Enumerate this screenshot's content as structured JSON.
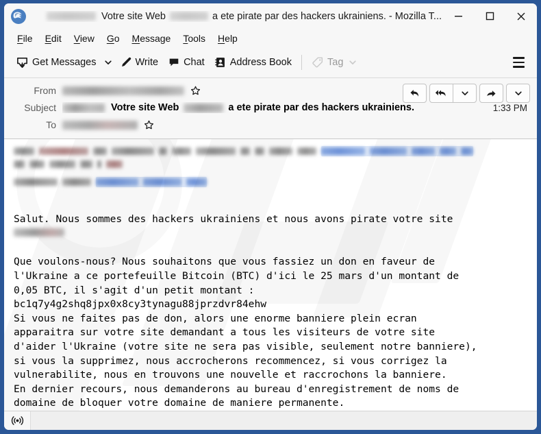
{
  "window": {
    "title_prefix_redacted": true,
    "title_part_1": "Votre site Web",
    "title_part_2": "a ete pirate par des hackers ukrainiens. - Mozilla T...",
    "logo_icon": "thunderbird-logo-icon",
    "controls": {
      "minimize": "minimize-icon",
      "maximize": "maximize-icon",
      "close": "close-icon"
    },
    "frame_color": "#2b5797"
  },
  "menubar": {
    "items": [
      {
        "label": "File",
        "accesskey": "F"
      },
      {
        "label": "Edit",
        "accesskey": "E"
      },
      {
        "label": "View",
        "accesskey": "V"
      },
      {
        "label": "Go",
        "accesskey": "G"
      },
      {
        "label": "Message",
        "accesskey": "M"
      },
      {
        "label": "Tools",
        "accesskey": "T"
      },
      {
        "label": "Help",
        "accesskey": "H"
      }
    ]
  },
  "toolbar": {
    "get_messages_label": "Get Messages",
    "get_messages_icon": "inbox-download-icon",
    "get_messages_caret": "chevron-down-icon",
    "write_label": "Write",
    "write_icon": "pencil-icon",
    "chat_label": "Chat",
    "chat_icon": "chat-bubble-icon",
    "address_book_label": "Address Book",
    "address_book_icon": "address-book-icon",
    "tag_label": "Tag",
    "tag_icon": "tag-icon",
    "tag_caret": "chevron-down-icon",
    "tag_disabled": true,
    "app_menu_icon": "hamburger-menu-icon"
  },
  "message_header": {
    "from_label": "From",
    "from_value_redacted": true,
    "subject_label": "Subject",
    "subject_bold_1": "Votre site Web",
    "subject_bold_2": "a ete pirate par des hackers ukrainiens.",
    "to_label": "To",
    "to_value_redacted": true,
    "time": "1:33 PM",
    "star_icon": "star-outline-icon",
    "actions": {
      "reply": "reply-icon",
      "reply_all": "reply-all-icon",
      "reply_all_caret": "chevron-down-icon",
      "forward": "forward-arrow-icon",
      "forward_caret": "chevron-down-icon"
    }
  },
  "message_body": {
    "preamble_redacted": true,
    "greeting_line": "Salut. Nous sommes des hackers ukrainiens et nous avons pirate votre site",
    "site_name_redacted": true,
    "paragraph_2_line_1": "Que voulons-nous? Nous souhaitons que vous fassiez un don en faveur de",
    "paragraph_2_line_2": "l'Ukraine a ce portefeuille Bitcoin (BTC) d'ici le 25 mars d'un montant de",
    "paragraph_2_line_3": "0,05 BTC, il s'agit d'un petit montant :",
    "bitcoin_address": "bc1q7y4g2shq8jpx0x8cy3tynagu88jprzdvr84ehw",
    "paragraph_3_line_1": "Si vous ne faites pas de don, alors une enorme banniere plein ecran",
    "paragraph_3_line_2": "apparaitra sur votre site demandant a tous les visiteurs de votre site",
    "paragraph_3_line_3": "d'aider l'Ukraine (votre site ne sera pas visible, seulement notre banniere),",
    "paragraph_3_line_4": "si vous la supprimez, nous accrocherons recommencez, si vous corrigez la",
    "paragraph_3_line_5": "vulnerabilite, nous en trouvons une nouvelle et raccrochons la banniere.",
    "paragraph_3_line_6": "En dernier recours, nous demanderons au bureau d'enregistrement de noms de",
    "paragraph_3_line_7": "domaine de bloquer votre domaine de maniere permanente."
  },
  "statusbar": {
    "connection_icon": "broadcast-online-icon",
    "text": ""
  }
}
